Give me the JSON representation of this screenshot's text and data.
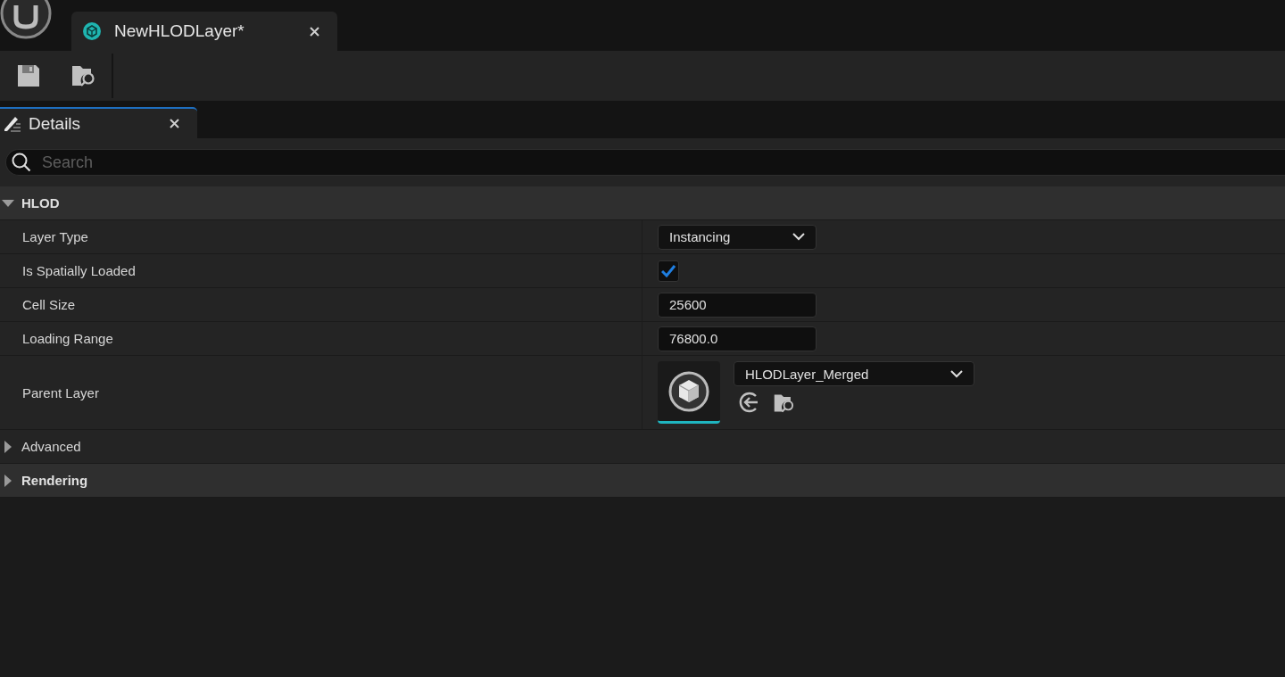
{
  "document_tab": {
    "title": "NewHLODLayer*",
    "selected": true
  },
  "panel_tab": {
    "title": "Details",
    "selected": true
  },
  "search": {
    "placeholder": "Search"
  },
  "sections": [
    {
      "kind": "category",
      "label": "HLOD",
      "expanded": true,
      "rows": [
        {
          "kind": "dropdown",
          "label": "Layer Type",
          "value": "Instancing"
        },
        {
          "kind": "checkbox",
          "label": "Is Spatially Loaded",
          "checked": true
        },
        {
          "kind": "number",
          "label": "Cell Size",
          "value": "25600"
        },
        {
          "kind": "number",
          "label": "Loading Range",
          "value": "76800.0"
        },
        {
          "kind": "asset",
          "label": "Parent Layer",
          "value": "HLODLayer_Merged"
        }
      ]
    },
    {
      "kind": "group",
      "label": "Advanced",
      "expanded": false
    },
    {
      "kind": "category",
      "label": "Rendering",
      "expanded": false
    }
  ]
}
